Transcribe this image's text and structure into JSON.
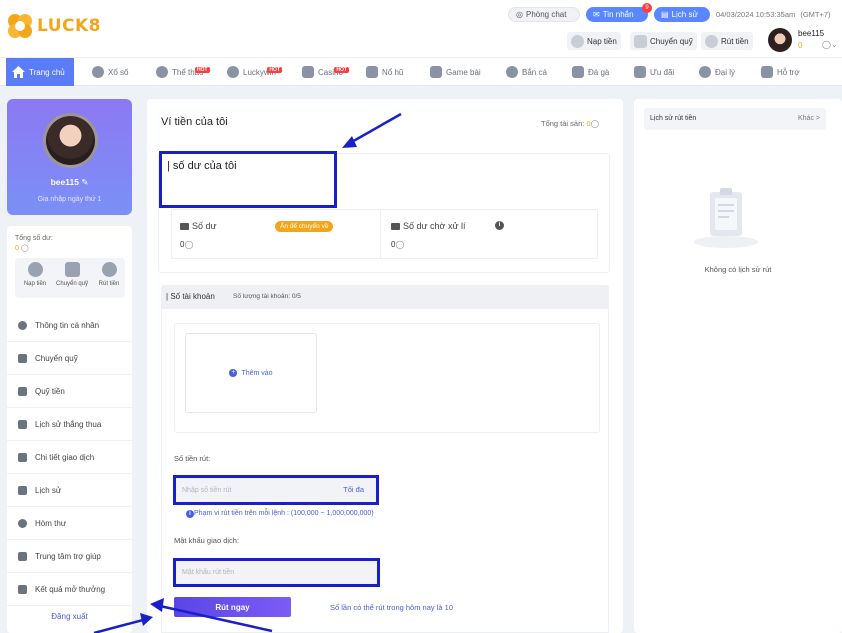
{
  "header": {
    "logo_text": "LUCK8",
    "chat_label": "Phòng chat",
    "messages_label": "Tin nhắn",
    "messages_badge": "9",
    "history_label": "Lịch sử",
    "datetime": "04/03/2024 10:53:35am",
    "timezone": "(GMT+7)",
    "deposit_label": "Nạp tiền",
    "transfer_label": "Chuyển quỹ",
    "withdraw_label": "Rút tiền",
    "username": "bee115",
    "balance": "0"
  },
  "nav": {
    "items": [
      {
        "label": "Trang chủ",
        "icon": "home-icon"
      },
      {
        "label": "Xổ số",
        "icon": "lottery-icon"
      },
      {
        "label": "Thể thao",
        "icon": "sports-icon",
        "hot": "HOT"
      },
      {
        "label": "Luckywin",
        "icon": "luckywin-icon",
        "hot": "HOT"
      },
      {
        "label": "Casino",
        "icon": "casino-icon",
        "hot": "HOT"
      },
      {
        "label": "Nổ hũ",
        "icon": "slots-icon"
      },
      {
        "label": "Game bài",
        "icon": "cards-icon"
      },
      {
        "label": "Bắn cá",
        "icon": "fish-icon"
      },
      {
        "label": "Đá gà",
        "icon": "rooster-icon"
      },
      {
        "label": "Ưu đãi",
        "icon": "gift-icon"
      },
      {
        "label": "Đại lý",
        "icon": "agent-icon"
      },
      {
        "label": "Hỗ trợ",
        "icon": "support-icon"
      }
    ]
  },
  "profile": {
    "username": "bee115",
    "joined": "Gia nhập ngày thứ 1",
    "total_balance_label": "Tổng số dư:",
    "total_balance": "0",
    "quick": [
      {
        "label": "Nạp tiền",
        "icon": "deposit-icon"
      },
      {
        "label": "Chuyển quỹ",
        "icon": "wallet-icon"
      },
      {
        "label": "Rút tiền",
        "icon": "withdraw-icon"
      }
    ]
  },
  "menu": {
    "items": [
      {
        "label": "Thông tin cá nhân",
        "icon": "user-icon"
      },
      {
        "label": "Chuyển quỹ",
        "icon": "transfer-icon"
      },
      {
        "label": "Quỹ tiền",
        "icon": "fund-icon"
      },
      {
        "label": "Lịch sử thắng thua",
        "icon": "record-icon"
      },
      {
        "label": "Chi tiết giao dịch",
        "icon": "transaction-icon"
      },
      {
        "label": "Lịch sử",
        "icon": "history-icon"
      },
      {
        "label": "Hòm thư",
        "icon": "mail-icon"
      },
      {
        "label": "Trung tâm trợ giúp",
        "icon": "help-icon"
      },
      {
        "label": "Kết quả mở thưởng",
        "icon": "trophy-icon"
      }
    ],
    "logout": "Đăng xuất"
  },
  "wallet": {
    "title": "Ví tiền của tôi",
    "total_assets_label": "Tổng tài sản:",
    "total_assets": "0",
    "my_balance_heading": "số dư của tôi",
    "balance_label": "Số dư",
    "balance_value": "0",
    "transfer_badge": "Ấn để chuyển về",
    "pending_label": "Số dư chờ xử lí",
    "pending_value": "0"
  },
  "accounts": {
    "title": "Số tài khoản",
    "count_label": "Số lượng tài khoản:",
    "count": "0/5",
    "add_label": "Thêm vào"
  },
  "withdraw": {
    "amount_label": "Số tiền rút:",
    "amount_placeholder": "Nhập số tiền rút",
    "max_label": "Tối đa",
    "range_note": "Phạm vi rút tiền trên mỗi lệnh : (100,000 ~ 1,000,000,000)",
    "password_label": "Mật khẩu giao dịch:",
    "password_placeholder": "Mật khẩu rút tiền",
    "submit_label": "Rút ngay",
    "remaining_note": "Số lần có thể rút trong hôm nay là 10"
  },
  "right_panel": {
    "title": "Lịch sử rút tiền",
    "more_label": "Khác >",
    "empty_text": "Không có lịch sử rút"
  },
  "colors": {
    "accent": "#5b7cf7",
    "highlight_border": "#1a20c9",
    "button_gradient": [
      "#5a46e6",
      "#7b5cf5"
    ],
    "badge_orange": "#f4a61a"
  }
}
